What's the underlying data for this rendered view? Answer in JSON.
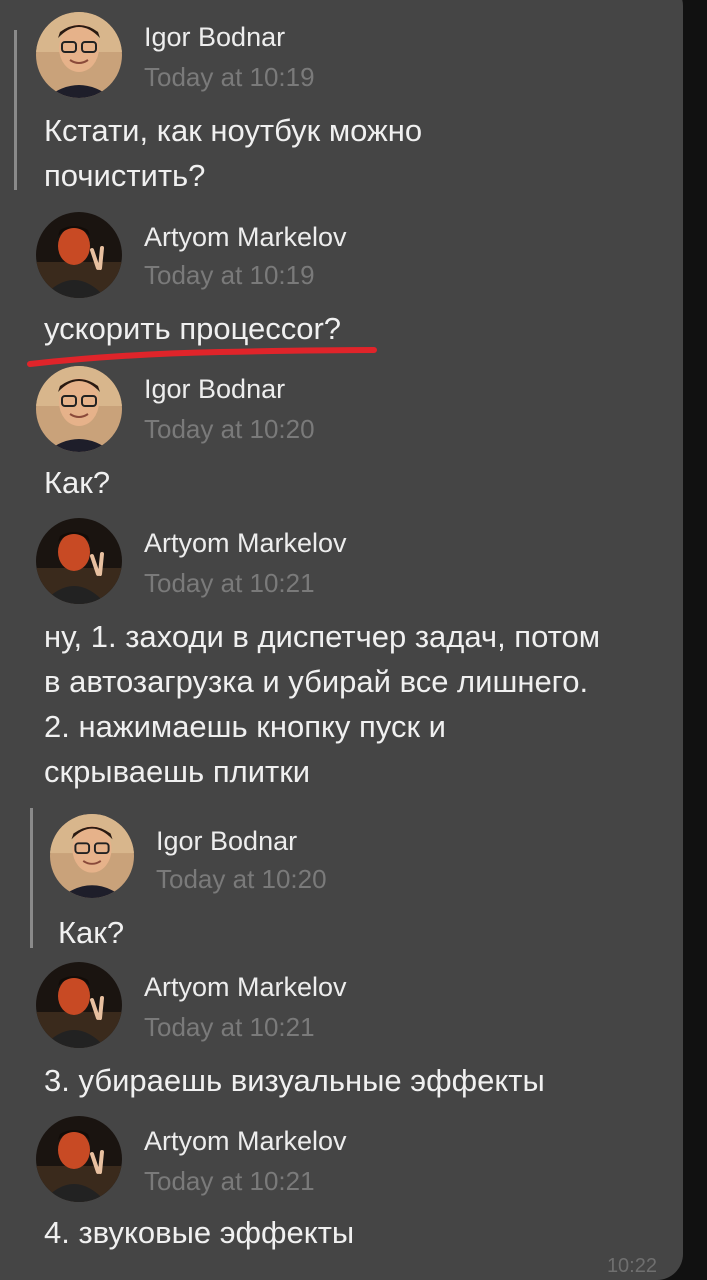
{
  "chat": {
    "messages": [
      {
        "author": "Igor Bodnar",
        "time": "Today at 10:19",
        "lines": [
          "Кстати, как ноутбук можно",
          "почистить?"
        ]
      },
      {
        "author": "Artyom Markelov",
        "time": "Today at 10:19",
        "lines": [
          "ускорить процессor?"
        ]
      },
      {
        "author": "Igor Bodnar",
        "time": "Today at 10:20",
        "lines": [
          "Как?"
        ]
      },
      {
        "author": "Artyom Markelov",
        "time": "Today at 10:21",
        "lines": [
          "ну, 1. заходи в диспетчер задач, потом",
          "в автозагрузка и убирай все лишнего.",
          "2. нажимаешь кнопку пуск и",
          "скрываешь плитки"
        ]
      },
      {
        "author": "Artyom Markelov",
        "time": "Today at 10:21",
        "lines": [
          "3. убираешь визуальные эффекты"
        ]
      },
      {
        "author": "Artyom Markelov",
        "time": "Today at 10:21",
        "lines": [
          "4. звуковые эффекты"
        ]
      }
    ],
    "quoted": {
      "author": "Igor Bodnar",
      "time": "Today at 10:20",
      "text": "Как?"
    },
    "bubble_time": "10:22"
  },
  "icons": {
    "igor_avatar": "avatar-igor-photo",
    "artyom_avatar": "avatar-artyom-photo"
  },
  "colors": {
    "bubble": "#454545",
    "background": "#111111",
    "underline": "#e0242a",
    "timestamp": "#7a7a7a"
  }
}
